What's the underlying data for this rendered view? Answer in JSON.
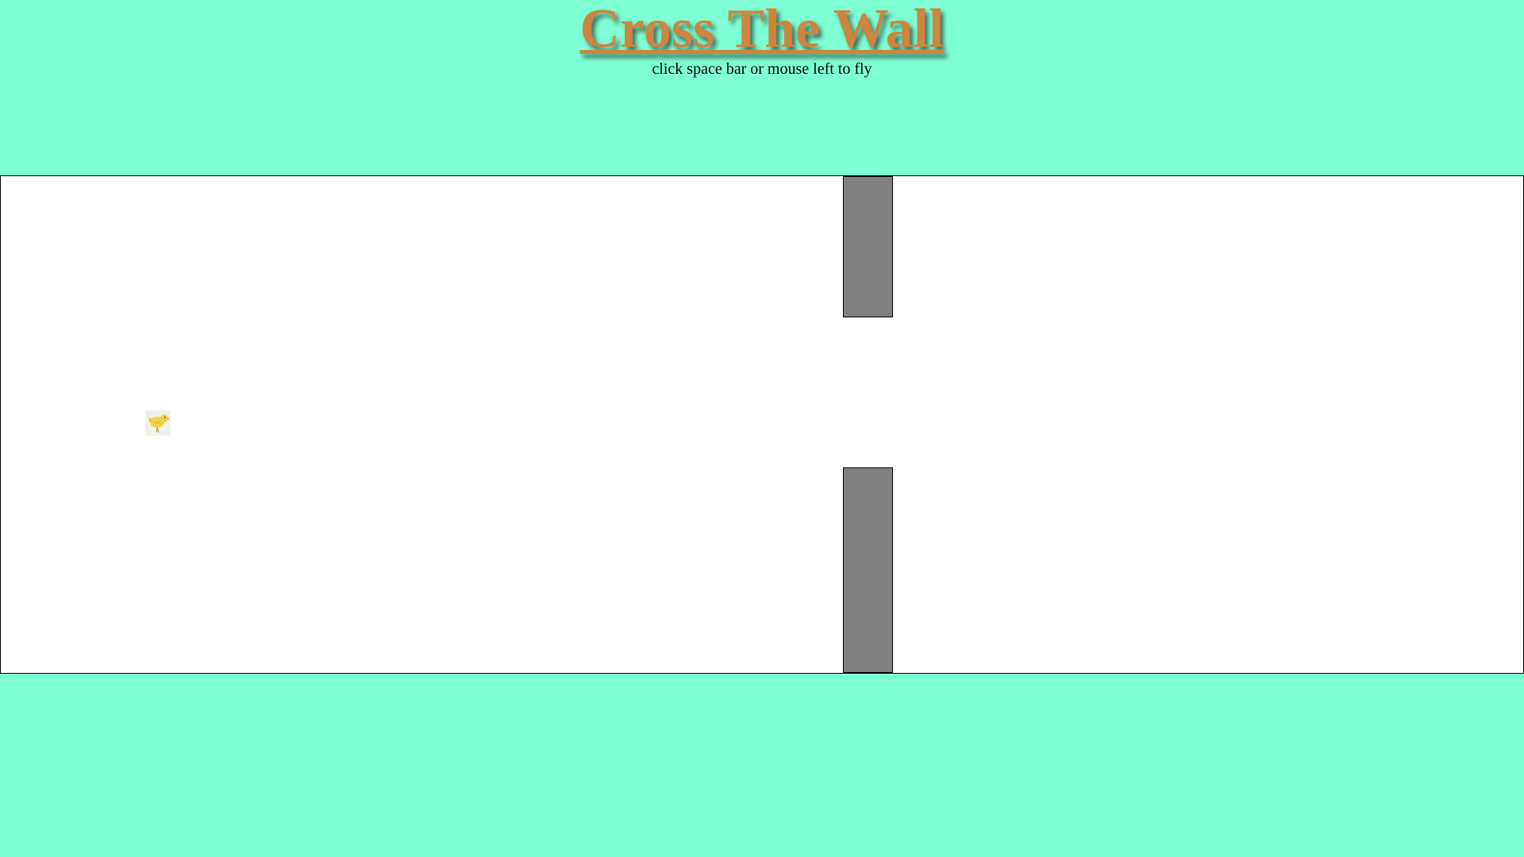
{
  "header": {
    "title": "Cross The Wall",
    "subtitle": "click space bar or mouse left to fly"
  },
  "game": {
    "player_icon": "bird-icon",
    "obstacle": "wall",
    "colors": {
      "page_background": "#7fffd4",
      "title": "#cd853f",
      "game_area": "#ffffff",
      "wall": "#808080",
      "bird": "#f5d442"
    }
  }
}
